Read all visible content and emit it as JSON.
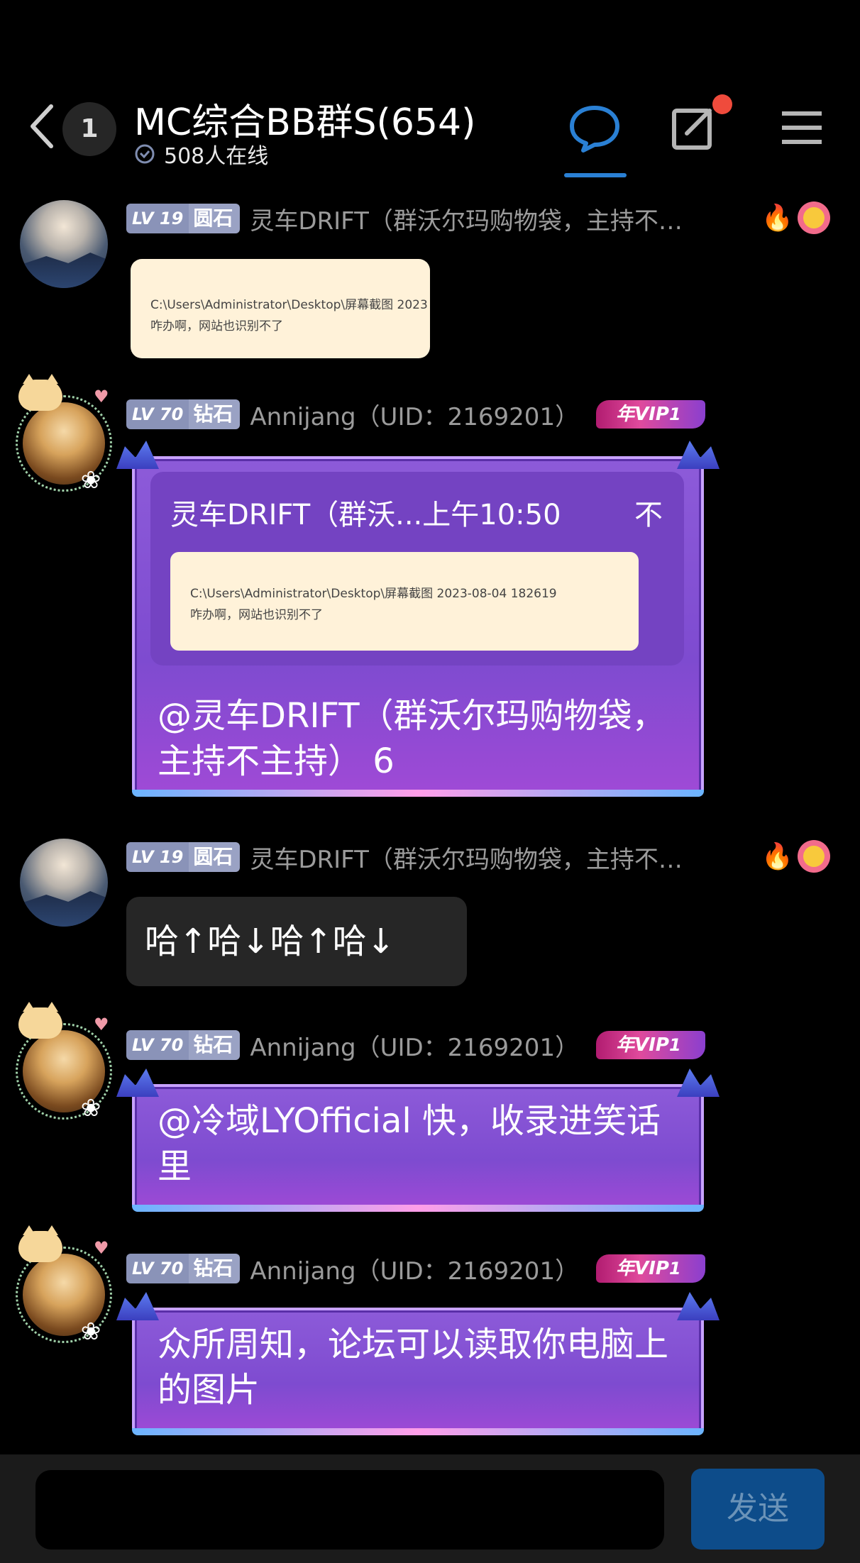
{
  "header": {
    "back_icon": "chevron-left-icon",
    "unread_count": "1",
    "title": "MC综合BB群S(654)",
    "online_text": "508人在线",
    "buttons": [
      "chat-bubble-icon",
      "edit-icon",
      "menu-icon"
    ],
    "accent": "#2a80d4",
    "badge_color": "#ef4b3c"
  },
  "messages": [
    {
      "level_num": "LV 19",
      "level_rank": "圆石",
      "username": "灵车DRIFT（群沃尔玛购物袋，主持不…",
      "badges": [
        "fire-icon",
        "smile-flower-icon"
      ],
      "image_lines": [
        "C:\\Users\\Administrator\\Desktop\\屏幕截图 2023",
        "咋办啊，网站也识别不了"
      ]
    },
    {
      "level_num": "LV 70",
      "level_rank": "钻石",
      "username": "Annijang（UID：2169201）",
      "vip_label": "年VIP",
      "vip_num": "1",
      "quote_header": "灵车DRIFT（群沃...上午10:50",
      "quote_expand": "不",
      "quote_image_lines": [
        "C:\\Users\\Administrator\\Desktop\\屏幕截图 2023-08-04 182619",
        "咋办啊，网站也识别不了"
      ],
      "text": "@灵车DRIFT（群沃尔玛购物袋，主持不主持） 6"
    },
    {
      "level_num": "LV 19",
      "level_rank": "圆石",
      "username": "灵车DRIFT（群沃尔玛购物袋，主持不…",
      "badges": [
        "fire-icon",
        "smile-flower-icon"
      ],
      "text": "哈↑哈↓哈↑哈↓"
    },
    {
      "level_num": "LV 70",
      "level_rank": "钻石",
      "username": "Annijang（UID：2169201）",
      "vip_label": "年VIP",
      "vip_num": "1",
      "text": "@冷域LYOfficial 快，收录进笑话里"
    },
    {
      "level_num": "LV 70",
      "level_rank": "钻石",
      "username": "Annijang（UID：2169201）",
      "vip_label": "年VIP",
      "vip_num": "1",
      "text": "众所周知，论坛可以读取你电脑上的图片"
    }
  ],
  "footer": {
    "input_value": "",
    "send_label": "发送"
  }
}
